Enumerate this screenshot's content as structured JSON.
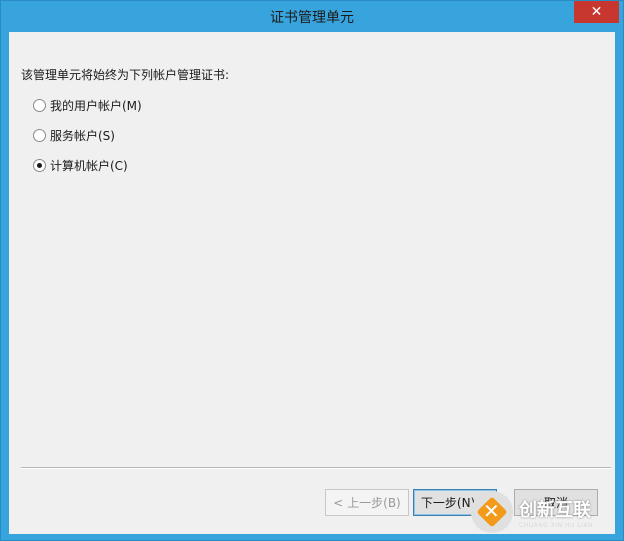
{
  "window": {
    "title": "证书管理单元",
    "close_glyph": "✕"
  },
  "content": {
    "prompt": "该管理单元将始终为下列帐户管理证书:",
    "options": [
      {
        "label": "我的用户帐户(M)",
        "checked": false
      },
      {
        "label": "服务帐户(S)",
        "checked": false
      },
      {
        "label": "计算机帐户(C)",
        "checked": true
      }
    ]
  },
  "buttons": {
    "back": "< 上一步(B)",
    "next": "下一步(N) >",
    "cancel": "取消"
  },
  "watermark": {
    "main": "创新互联",
    "sub": "CHUANG XIN HU LIAN"
  },
  "colors": {
    "frame": "#38a4dd",
    "close": "#c7372f",
    "client_bg": "#f0f0f0",
    "accent": "#f39a1b"
  }
}
